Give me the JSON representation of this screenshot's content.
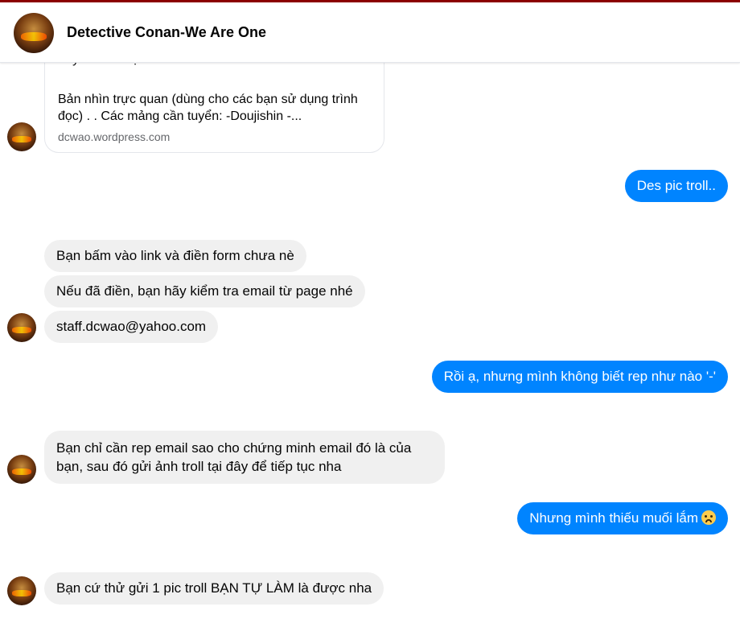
{
  "header": {
    "title": "Detective Conan-We Are One",
    "avatar_icon": "halloween-avatar-icon"
  },
  "link_card": {
    "partial_title": "Tuyển nhân lực - C",
    "description": "Bản nhìn trực quan (dùng cho các bạn sử dụng trình đọc) . . Các mảng cần tuyển: -Doujishin -...",
    "domain": "dcwao.wordpress.com"
  },
  "messages": {
    "m1": "Des pic troll..",
    "m2": "Bạn bấm vào link và điền form chưa nè",
    "m3": "Nếu đã điền, bạn hãy kiểm tra email từ page nhé",
    "m4": "staff.dcwao@yahoo.com",
    "m5": "Rồi ạ, nhưng mình không biết rep như nào '-'",
    "m6": "Bạn chỉ cần rep email sao cho chứng minh email đó là của bạn, sau đó gửi ảnh troll tại đây để tiếp tục nha",
    "m7": "Nhưng mình thiếu muối lắm",
    "m7_emoji": "worried-face-emoji",
    "m8": "Bạn cứ thử gửi 1 pic troll BẠN TỰ LÀM là được nha"
  },
  "colors": {
    "outgoing_bubble": "#0084ff",
    "incoming_bubble": "#f0f0f0",
    "top_accent": "#8b0000"
  }
}
